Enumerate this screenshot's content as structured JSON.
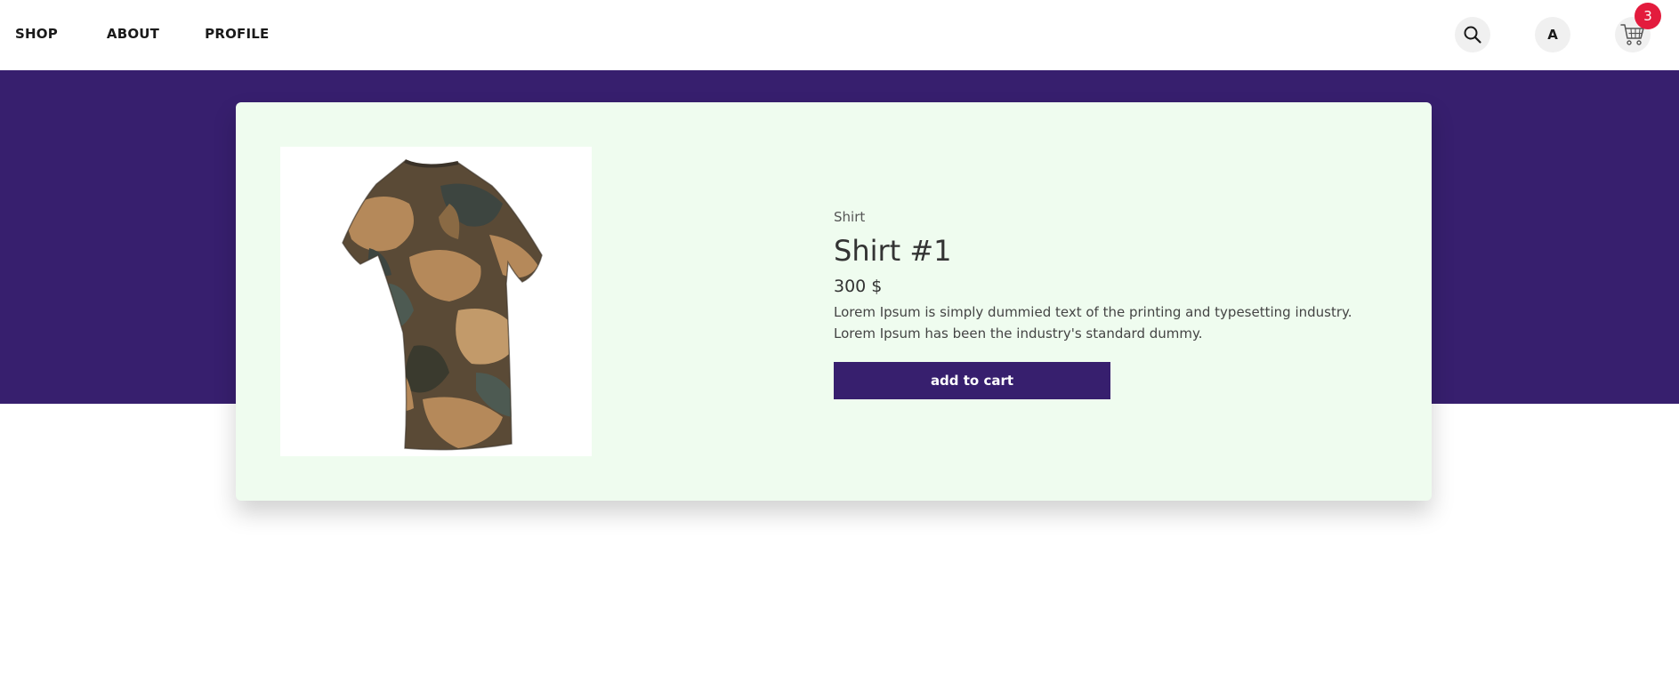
{
  "nav": {
    "links": [
      {
        "label": "SHOP"
      },
      {
        "label": "ABOUT"
      },
      {
        "label": "PROFILE"
      }
    ],
    "profile_initial": "A",
    "cart_count": "3",
    "search_icon": "search-icon",
    "cart_icon": "shopping-cart-icon"
  },
  "product": {
    "category": "Shirt",
    "title": "Shirt #1",
    "price": "300 $",
    "description": "Lorem Ipsum is simply dummied text of the printing and typesetting industry. Lorem Ipsum has been the industry's standard dummy.",
    "add_to_cart_label": "add to cart",
    "image_icon": "camouflage-tshirt-image"
  },
  "colors": {
    "brand": "#371f6e",
    "card_background": "#effcef",
    "badge": "#e31b3d"
  }
}
